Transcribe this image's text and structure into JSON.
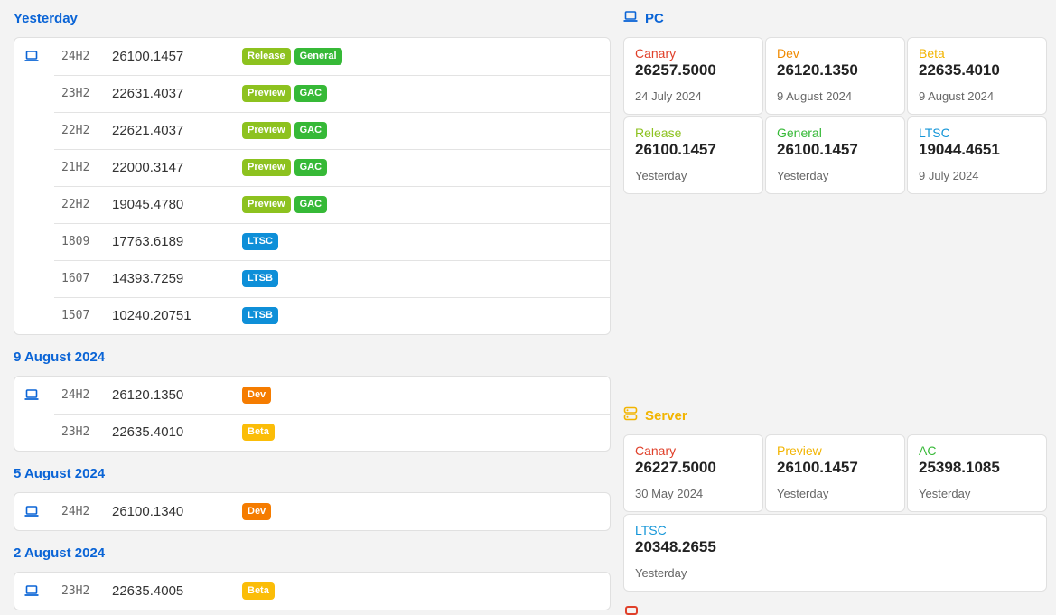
{
  "colors": {
    "release": "#8dc21f",
    "general": "#36b937",
    "preview": "#8dc21f",
    "gac": "#36b937",
    "ltsc": "#0e8fd8",
    "ltsb": "#0e8fd8",
    "dev": "#f57c00",
    "beta": "#fbbd08",
    "canary": "#e0402a",
    "dev_text": "#f08a00",
    "beta_text": "#f2b400",
    "release_text": "#8dc21f",
    "general_text": "#36b937",
    "ltsc_text": "#1496d8",
    "preview_text": "#f2b400",
    "ac_text": "#36b937"
  },
  "groups": [
    {
      "title": "Yesterday",
      "rows": [
        {
          "icon": "laptop-icon",
          "version": "24H2",
          "build": "26100.1457",
          "badges": [
            {
              "label": "Release",
              "type": "release"
            },
            {
              "label": "General",
              "type": "general"
            }
          ]
        },
        {
          "icon": "",
          "version": "23H2",
          "build": "22631.4037",
          "badges": [
            {
              "label": "Preview",
              "type": "preview"
            },
            {
              "label": "GAC",
              "type": "gac"
            }
          ]
        },
        {
          "icon": "",
          "version": "22H2",
          "build": "22621.4037",
          "badges": [
            {
              "label": "Preview",
              "type": "preview"
            },
            {
              "label": "GAC",
              "type": "gac"
            }
          ]
        },
        {
          "icon": "",
          "version": "21H2",
          "build": "22000.3147",
          "badges": [
            {
              "label": "Preview",
              "type": "preview"
            },
            {
              "label": "GAC",
              "type": "gac"
            }
          ]
        },
        {
          "icon": "",
          "version": "22H2",
          "build": "19045.4780",
          "badges": [
            {
              "label": "Preview",
              "type": "preview"
            },
            {
              "label": "GAC",
              "type": "gac"
            }
          ]
        },
        {
          "icon": "",
          "version": "1809",
          "build": "17763.6189",
          "badges": [
            {
              "label": "LTSC",
              "type": "ltsc"
            }
          ]
        },
        {
          "icon": "",
          "version": "1607",
          "build": "14393.7259",
          "badges": [
            {
              "label": "LTSB",
              "type": "ltsb"
            }
          ]
        },
        {
          "icon": "",
          "version": "1507",
          "build": "10240.20751",
          "badges": [
            {
              "label": "LTSB",
              "type": "ltsb"
            }
          ]
        }
      ]
    },
    {
      "title": "9 August 2024",
      "rows": [
        {
          "icon": "laptop-icon",
          "version": "24H2",
          "build": "26120.1350",
          "badges": [
            {
              "label": "Dev",
              "type": "dev"
            }
          ]
        },
        {
          "icon": "",
          "version": "23H2",
          "build": "22635.4010",
          "badges": [
            {
              "label": "Beta",
              "type": "beta"
            }
          ]
        }
      ]
    },
    {
      "title": "5 August 2024",
      "rows": [
        {
          "icon": "laptop-icon",
          "version": "24H2",
          "build": "26100.1340",
          "badges": [
            {
              "label": "Dev",
              "type": "dev"
            }
          ]
        }
      ]
    },
    {
      "title": "2 August 2024",
      "rows": [
        {
          "icon": "laptop-icon",
          "version": "23H2",
          "build": "22635.4005",
          "badges": [
            {
              "label": "Beta",
              "type": "beta"
            }
          ]
        }
      ]
    }
  ],
  "pc": {
    "title": "PC",
    "tiles": [
      {
        "channel": "Canary",
        "color": "canary",
        "build": "26257.5000",
        "date": "24 July 2024"
      },
      {
        "channel": "Dev",
        "color": "dev_text",
        "build": "26120.1350",
        "date": "9 August 2024"
      },
      {
        "channel": "Beta",
        "color": "beta_text",
        "build": "22635.4010",
        "date": "9 August 2024"
      },
      {
        "channel": "Release",
        "color": "release_text",
        "build": "26100.1457",
        "date": "Yesterday"
      },
      {
        "channel": "General",
        "color": "general_text",
        "build": "26100.1457",
        "date": "Yesterday"
      },
      {
        "channel": "LTSC",
        "color": "ltsc_text",
        "build": "19044.4651",
        "date": "9 July 2024"
      }
    ]
  },
  "server": {
    "title": "Server",
    "tiles": [
      {
        "channel": "Canary",
        "color": "canary",
        "build": "26227.5000",
        "date": "30 May 2024"
      },
      {
        "channel": "Preview",
        "color": "preview_text",
        "build": "26100.1457",
        "date": "Yesterday"
      },
      {
        "channel": "AC",
        "color": "ac_text",
        "build": "25398.1085",
        "date": "Yesterday"
      },
      {
        "channel": "LTSC",
        "color": "ltsc_text",
        "build": "20348.2655",
        "date": "Yesterday"
      }
    ]
  }
}
